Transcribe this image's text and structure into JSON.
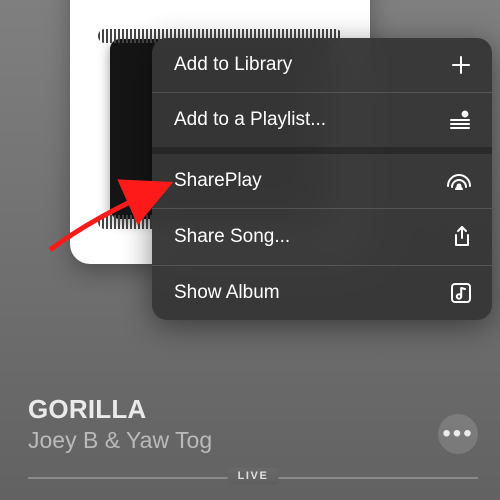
{
  "song": {
    "title": "GORILLA",
    "artist": "Joey B & Yaw Tog"
  },
  "menu": {
    "add_library": "Add to Library",
    "add_playlist": "Add to a Playlist...",
    "shareplay": "SharePlay",
    "share_song": "Share Song...",
    "show_album": "Show Album"
  },
  "progress": {
    "live_label": "LIVE"
  },
  "icons": {
    "plus": "plus-icon",
    "playlist": "playlist-add-icon",
    "shareplay": "shareplay-icon",
    "share": "share-icon",
    "album": "album-icon",
    "more": "more-icon"
  },
  "colors": {
    "menu_bg": "#373737",
    "accent_arrow": "#ff0000"
  }
}
